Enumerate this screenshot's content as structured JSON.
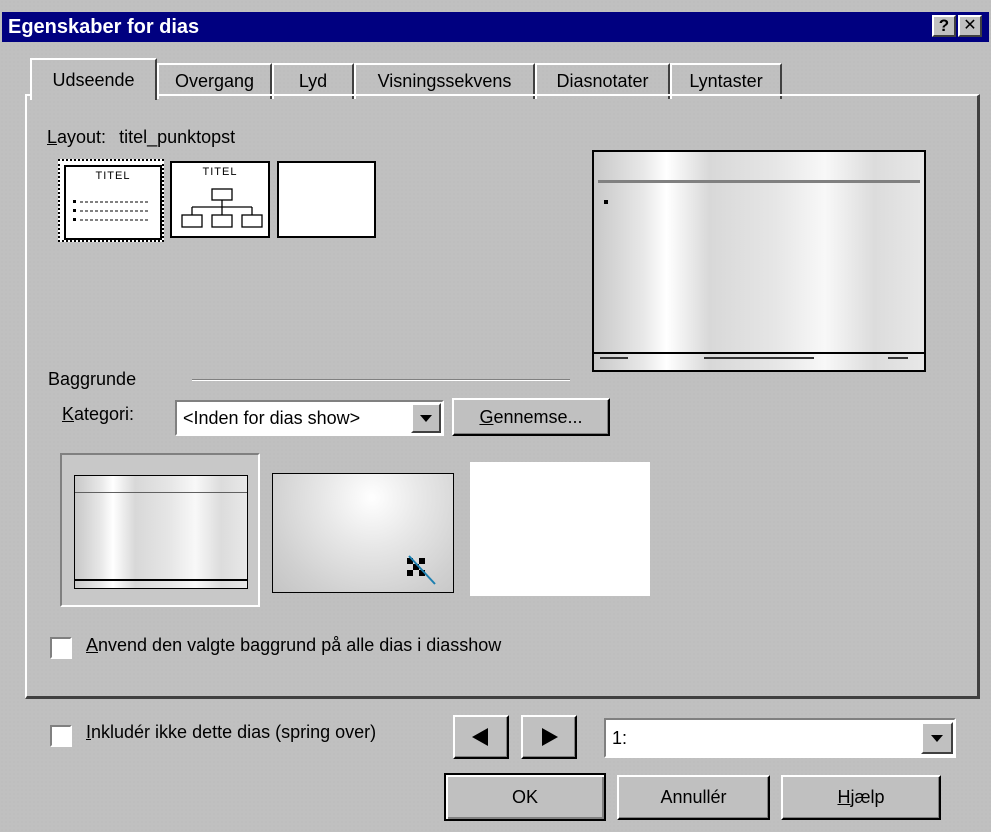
{
  "window": {
    "title": "Egenskaber for dias",
    "help_button": "?",
    "close_button": "✕"
  },
  "tabs": [
    {
      "label": "Udseende",
      "active": true
    },
    {
      "label": "Overgang",
      "active": false
    },
    {
      "label": "Lyd",
      "active": false
    },
    {
      "label": "Visningssekvens",
      "active": false
    },
    {
      "label": "Diasnotater",
      "active": false
    },
    {
      "label": "Lyntaster",
      "active": false
    }
  ],
  "layout": {
    "label_accel": "L",
    "label_rest": "ayout:",
    "value": "titel_punktopst",
    "thumb1_title": "TITEL",
    "thumb2_title": "TITEL"
  },
  "background": {
    "group_label": "Baggrunde",
    "category_label_accel": "K",
    "category_label_rest": "ategori:",
    "category_value": "<Inden for dias show>",
    "browse_accel": "G",
    "browse_rest": "ennemse..."
  },
  "apply_all": {
    "accel": "A",
    "rest": "nvend den valgte baggrund på alle dias i diasshow",
    "checked": false
  },
  "skip_slide": {
    "accel": "I",
    "rest": "nkludér ikke dette dias (spring over)",
    "checked": false
  },
  "nav": {
    "prev_icon": "triangle-left-icon",
    "next_icon": "triangle-right-icon",
    "slide_value": "1:"
  },
  "buttons": {
    "ok": "OK",
    "cancel": "Annullér",
    "help_accel": "H",
    "help_rest": "jælp"
  }
}
